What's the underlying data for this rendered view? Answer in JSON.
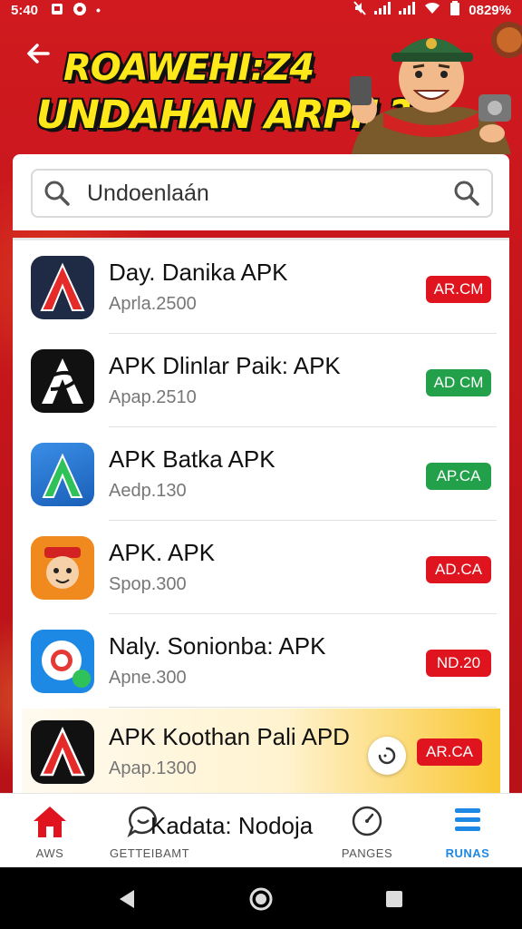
{
  "status_bar": {
    "time": "5:40",
    "battery": "0829%"
  },
  "header": {
    "banner_line1": "ROAWEHI:Z4",
    "banner_line2": "UNDAHAN ARPIL?"
  },
  "search": {
    "value": "Undoenlaán",
    "placeholder": "Undoenlaán"
  },
  "apps": [
    {
      "name": "Day. Danika APK",
      "sub": "Aprla.2500",
      "badge": "AR.CM",
      "badge_color": "#e0141e"
    },
    {
      "name": "APK Dlinlar Paik: APK",
      "sub": "Apap.2510",
      "badge": "AD CM",
      "badge_color": "#22a04a"
    },
    {
      "name": "APK Batka APK",
      "sub": "Aedp.130",
      "badge": "AP.CA",
      "badge_color": "#22a04a"
    },
    {
      "name": "APK. APK",
      "sub": "Spop.300",
      "badge": "AD.CA",
      "badge_color": "#e0141e"
    },
    {
      "name": "Naly. Sonionba: APK",
      "sub": "Apne.300",
      "badge": "ND.20",
      "badge_color": "#e0141e"
    },
    {
      "name": "APK Koothan Pali APD",
      "sub": "Apap.1300",
      "badge": "AR.CA",
      "badge_color": "#e0141e"
    }
  ],
  "bottom_nav": {
    "home_label": "AWS",
    "chat_label": "GETTEIBAMT",
    "center_text": "Kadata: Nodoja",
    "ranking_label": "PANGES",
    "menu_label": "RUNAS"
  },
  "colors": {
    "brand_red": "#c8141c",
    "banner_yellow": "#ffe81a",
    "badge_red": "#e0141e",
    "badge_green": "#22a04a",
    "active_blue": "#1e88e5"
  }
}
